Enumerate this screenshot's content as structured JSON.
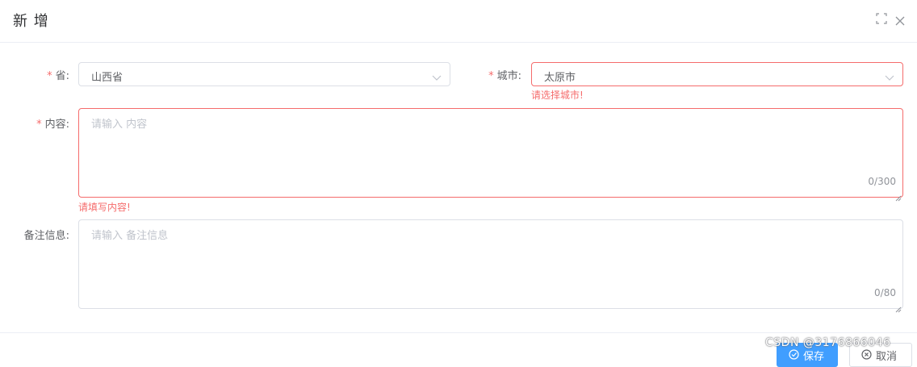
{
  "dialog": {
    "title": "新 增"
  },
  "form": {
    "province": {
      "label": "省:",
      "value": "山西省"
    },
    "city": {
      "label": "城市:",
      "value": "太原市",
      "error": "请选择城市!"
    },
    "content": {
      "label": "内容:",
      "placeholder": "请输入 内容",
      "count": "0/300",
      "error": "请填写内容!"
    },
    "remark": {
      "label": "备注信息:",
      "placeholder": "请输入 备注信息",
      "count": "0/80"
    }
  },
  "footer": {
    "save_label": "保存",
    "cancel_label": "取消"
  },
  "watermark": "CSDN @3176866046",
  "colors": {
    "primary": "#409eff",
    "error": "#f56c6c",
    "border": "#dcdfe6",
    "placeholder": "#c0c4cc"
  }
}
